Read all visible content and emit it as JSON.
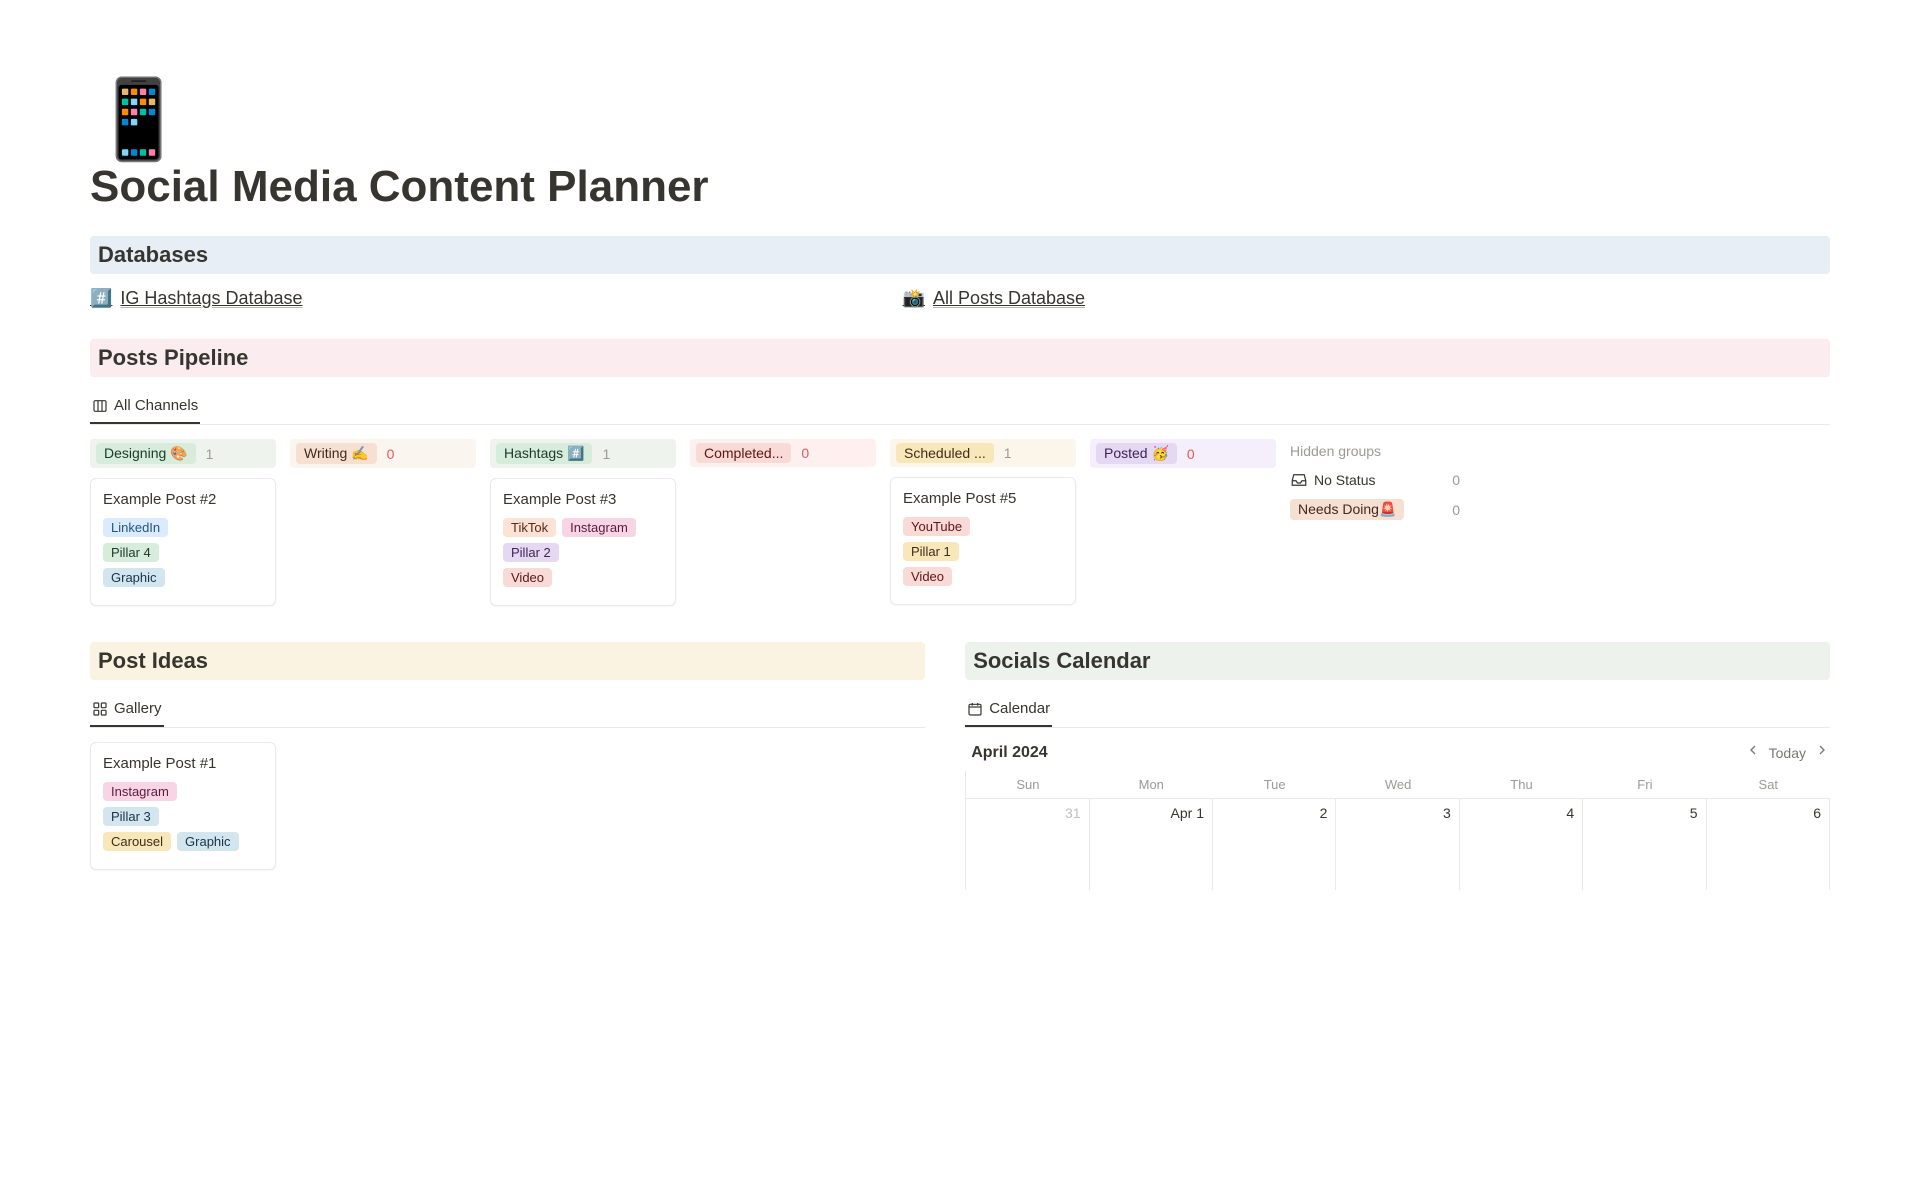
{
  "page": {
    "icon": "📱",
    "title": "Social Media Content Planner"
  },
  "sections": {
    "databases": "Databases",
    "pipeline": "Posts Pipeline",
    "ideas": "Post Ideas",
    "calendar": "Socials Calendar"
  },
  "databases": {
    "hashtags": {
      "emoji": "#️⃣",
      "label": "IG Hashtags Database"
    },
    "posts": {
      "emoji": "📸",
      "label": "All Posts Database"
    }
  },
  "pipeline": {
    "tab": "All Channels",
    "columns": {
      "designing": {
        "label": "Designing 🎨",
        "count": "1"
      },
      "writing": {
        "label": "Writing ✍️",
        "count": "0"
      },
      "hashtags": {
        "label": "Hashtags #️⃣",
        "count": "1"
      },
      "completed": {
        "label": "Completed...",
        "count": "0"
      },
      "scheduled": {
        "label": "Scheduled ...",
        "count": "1"
      },
      "posted": {
        "label": "Posted 🥳",
        "count": "0"
      }
    },
    "hidden": {
      "title": "Hidden groups",
      "nostatus": {
        "label": "No Status",
        "count": "0"
      },
      "needsdoing": {
        "label": "Needs Doing🚨",
        "count": "0"
      }
    },
    "cards": {
      "c2": {
        "title": "Example Post #2",
        "tags": {
          "linkedin": "LinkedIn",
          "pillar4": "Pillar 4",
          "graphic": "Graphic"
        }
      },
      "c3": {
        "title": "Example Post #3",
        "tags": {
          "tiktok": "TikTok",
          "instagram": "Instagram",
          "pillar2": "Pillar 2",
          "video": "Video"
        }
      },
      "c5": {
        "title": "Example Post #5",
        "tags": {
          "youtube": "YouTube",
          "pillar1": "Pillar 1",
          "video": "Video"
        }
      }
    }
  },
  "ideas": {
    "tab": "Gallery",
    "card": {
      "title": "Example Post #1",
      "tags": {
        "instagram": "Instagram",
        "pillar3": "Pillar 3",
        "carousel": "Carousel",
        "graphic": "Graphic"
      }
    }
  },
  "calendar": {
    "tab": "Calendar",
    "month": "April 2024",
    "today": "Today",
    "dow": {
      "sun": "Sun",
      "mon": "Mon",
      "tue": "Tue",
      "wed": "Wed",
      "thu": "Thu",
      "fri": "Fri",
      "sat": "Sat"
    },
    "cells": {
      "d31": "31",
      "d1": "Apr 1",
      "d2": "2",
      "d3": "3",
      "d4": "4",
      "d5": "5",
      "d6": "6"
    }
  }
}
